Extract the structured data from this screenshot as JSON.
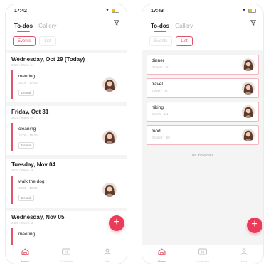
{
  "colors": {
    "accent": "#e0556a",
    "fab": "#ea3c58",
    "inactive": "#bdbdbd"
  },
  "icons": [
    "wifi-icon",
    "battery-icon",
    "filter-icon",
    "plus-icon",
    "home-icon",
    "gallery-icon",
    "profile-icon",
    "avatar-photo"
  ],
  "screens": [
    {
      "status_time": "17:42",
      "tabs": [
        {
          "label": "To-dos",
          "active": true
        },
        {
          "label": "Gallery",
          "active": false
        }
      ],
      "segments": [
        {
          "label": "Events",
          "active": true
        },
        {
          "label": "List",
          "active": false
        }
      ],
      "days": [
        {
          "title": "Wednesday, Oct 29 (Today)",
          "subtitle": "2025 / Week 44",
          "events": [
            {
              "name": "meeting",
              "time": "16:00 - 17:00",
              "tag": "Default"
            }
          ]
        },
        {
          "title": "Friday, Oct 31",
          "subtitle": "2025 / Week 44",
          "events": [
            {
              "name": "cleaning",
              "time": "15:00 - 15:30",
              "tag": "Default"
            }
          ]
        },
        {
          "title": "Tuesday, Nov 04",
          "subtitle": "2025 / Week 45",
          "events": [
            {
              "name": "walk the dog",
              "time": "18:00 - 19:00",
              "tag": "Default"
            }
          ]
        },
        {
          "title": "Wednesday, Nov 05",
          "subtitle": "2025 / Week 45",
          "events": [
            {
              "name": "meeting",
              "time": "",
              "tag": ""
            }
          ]
        }
      ],
      "nav": [
        {
          "label": "Home",
          "active": true
        },
        {
          "label": "Collection",
          "active": false
        },
        {
          "label": "Mine",
          "active": false
        }
      ]
    },
    {
      "status_time": "17:43",
      "tabs": [
        {
          "label": "To-dos",
          "active": true
        },
        {
          "label": "Gallery",
          "active": false
        }
      ],
      "segments": [
        {
          "label": "Events",
          "active": false
        },
        {
          "label": "List",
          "active": true
        }
      ],
      "list_items": [
        {
          "name": "dinner",
          "meta": "Dinners  ·  8/1"
        },
        {
          "name": "travel",
          "meta": "Travel  ·  1/4"
        },
        {
          "name": "hiking",
          "meta": "Sports  ·  1/4"
        },
        {
          "name": "food",
          "meta": "Dessert  ·  3/5"
        }
      ],
      "no_more": "No more data",
      "nav": [
        {
          "label": "Home",
          "active": true
        },
        {
          "label": "Collection",
          "active": false
        },
        {
          "label": "Mine",
          "active": false
        }
      ]
    }
  ]
}
